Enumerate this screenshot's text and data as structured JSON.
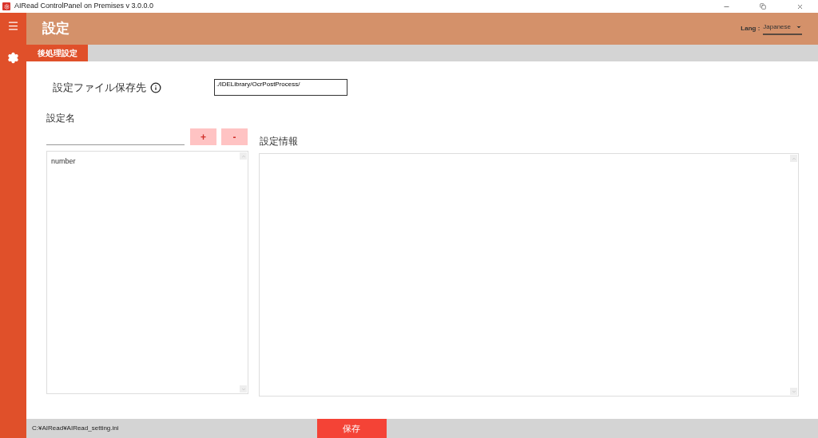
{
  "window": {
    "title": "AIRead ControlPanel on Premises v 3.0.0.0"
  },
  "header": {
    "title": "設定",
    "lang_label": "Lang :",
    "lang_value": "Japanese"
  },
  "tabs": [
    {
      "label": "後処理設定",
      "selected": true
    }
  ],
  "save_path": {
    "label": "設定ファイル保存先",
    "value": "./IDELibrary/OcrPostProcess/"
  },
  "setting_name": {
    "label": "設定名",
    "add": "+",
    "remove": "-",
    "items": [
      {
        "label": "number",
        "selected": false
      }
    ]
  },
  "setting_info": {
    "label": "設定情報"
  },
  "status_bar": {
    "path": "C:¥AIRead¥AIRead_setting.ini",
    "save": "保存"
  }
}
